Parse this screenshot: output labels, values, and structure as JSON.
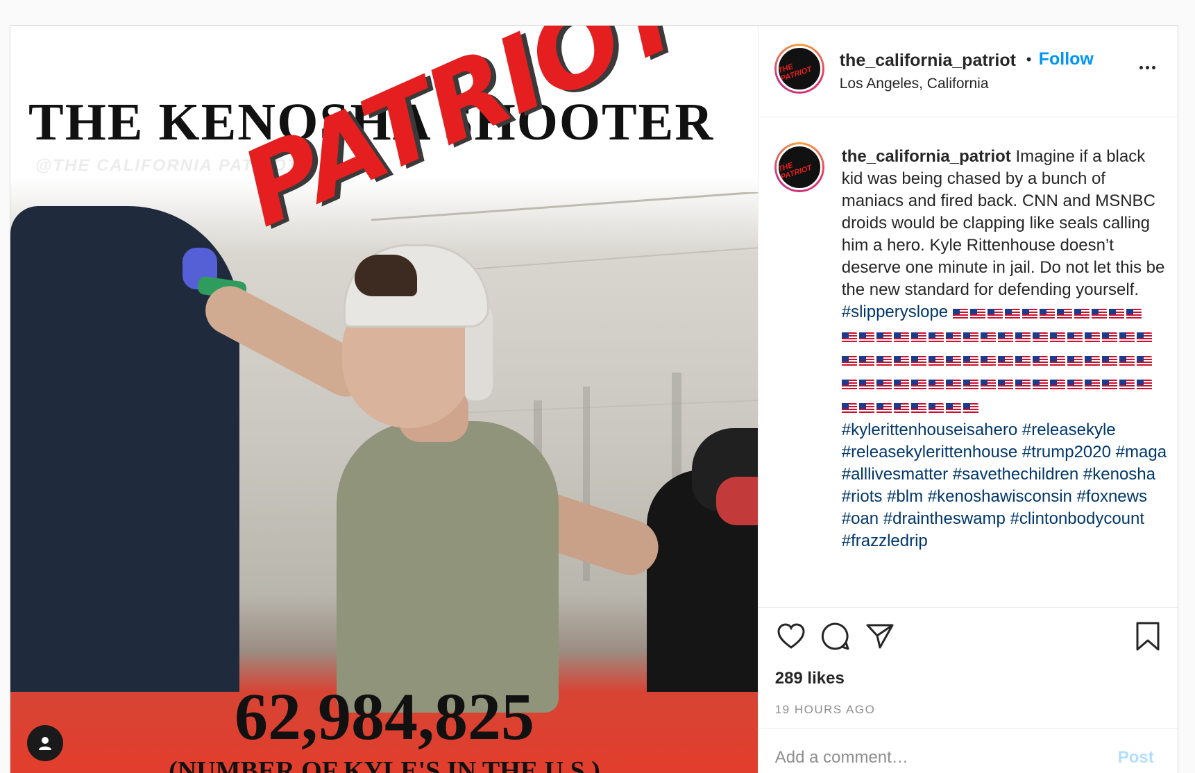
{
  "media": {
    "headline": "THE KENOSHA SHOOTER",
    "watermark": "@THE CALIFORNIA PATRIOT",
    "overlay_word": "PATRIOT",
    "big_number": "62,984,825",
    "big_sub": "(NUMBER OF KYLE'S IN THE U.S.)",
    "tag_icon": "user-icon"
  },
  "header": {
    "avatar_text": "THE PATRIOT",
    "username": "the_california_patriot",
    "separator": "•",
    "follow_label": "Follow",
    "location": "Los Angeles, California",
    "more_icon": "more-options-icon"
  },
  "caption": {
    "username": "the_california_patriot",
    "text": "Imagine if a black kid was being chased by a bunch of maniacs and fired back. CNN and MSNBC droids would be clapping like seals calling him a hero. Kyle Rittenhouse doesn’t deserve one minute in jail. Do not let this be the new standard for defending yourself.",
    "first_hashtag": "#slipperyslope",
    "flag_rows": [
      11,
      18,
      18,
      18,
      8
    ],
    "hashtags": [
      "#kylerittenhouseisahero",
      "#releasekyle",
      "#releasekylerittenhouse",
      "#trump2020",
      "#maga",
      "#alllivesmatter",
      "#savethechildren",
      "#kenosha",
      "#riots",
      "#blm",
      "#kenoshawisconsin",
      "#foxnews",
      "#oan",
      "#draintheswamp",
      "#clintonbodycount",
      "#frazzledrip"
    ]
  },
  "actions": {
    "like_icon": "heart-icon",
    "comment_icon": "comment-icon",
    "share_icon": "paper-plane-icon",
    "save_icon": "bookmark-icon",
    "likes": "289 likes",
    "time": "19 HOURS AGO"
  },
  "comment": {
    "placeholder": "Add a comment…",
    "post_label": "Post"
  },
  "colors": {
    "accent": "#0095f6",
    "post_disabled": "#b2dffc",
    "hashtag": "#00376b",
    "patriot_red": "#e51f1f",
    "bottom_banner": "#e33d2c"
  }
}
